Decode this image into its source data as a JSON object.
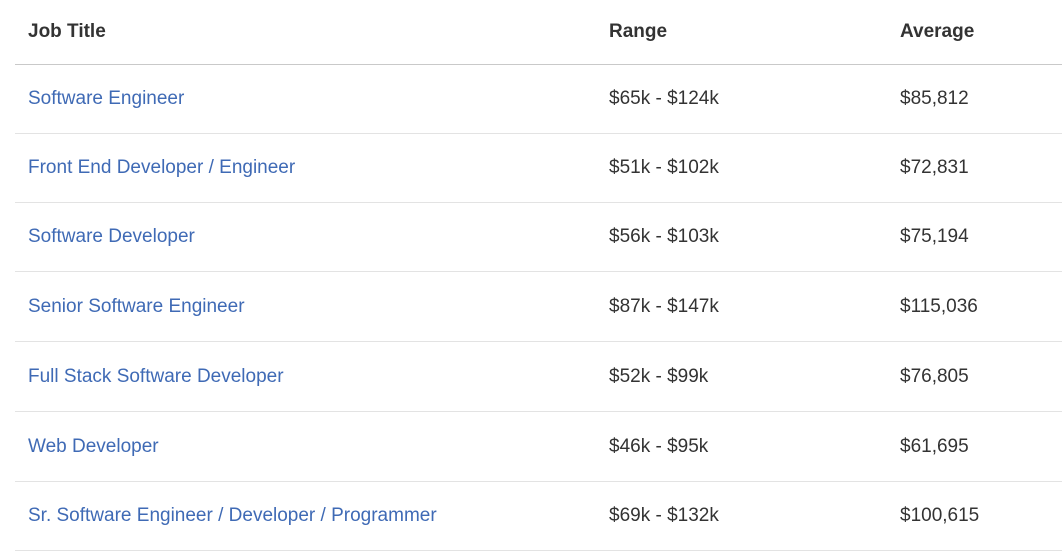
{
  "table": {
    "headers": {
      "title": "Job Title",
      "range": "Range",
      "average": "Average"
    },
    "rows": [
      {
        "title": "Software Engineer",
        "range": "$65k - $124k",
        "average": "$85,812"
      },
      {
        "title": "Front End Developer / Engineer",
        "range": "$51k - $102k",
        "average": "$72,831"
      },
      {
        "title": "Software Developer",
        "range": "$56k - $103k",
        "average": "$75,194"
      },
      {
        "title": "Senior Software Engineer",
        "range": "$87k - $147k",
        "average": "$115,036"
      },
      {
        "title": "Full Stack Software Developer",
        "range": "$52k - $99k",
        "average": "$76,805"
      },
      {
        "title": "Web Developer",
        "range": "$46k - $95k",
        "average": "$61,695"
      },
      {
        "title": "Sr. Software Engineer / Developer / Programmer",
        "range": "$69k - $132k",
        "average": "$100,615"
      }
    ]
  },
  "colors": {
    "link": "#3f6ab5",
    "text": "#333333",
    "divider": "#e3e3e3"
  }
}
